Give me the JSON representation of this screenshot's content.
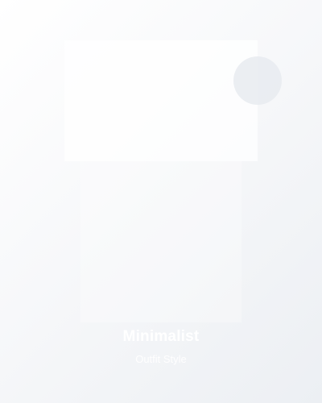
{
  "card": {
    "title": "Minimalist",
    "subtitle": "Outfit Style"
  },
  "colors": {
    "background_start": "#ffffff",
    "background_end": "#eceff3",
    "text": "#ffffff",
    "accent_circle": "#e8ebf0"
  },
  "icons": {
    "decorative_circle": "circle-icon"
  }
}
